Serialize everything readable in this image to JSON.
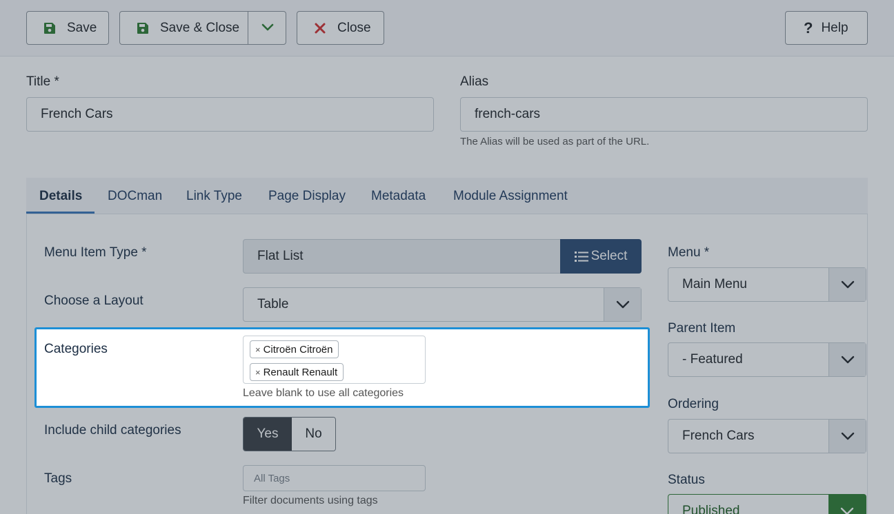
{
  "toolbar": {
    "save": "Save",
    "save_close": "Save & Close",
    "close": "Close",
    "help": "Help",
    "help_glyph": "?"
  },
  "title_field": {
    "label": "Title *",
    "value": "French Cars"
  },
  "alias_field": {
    "label": "Alias",
    "value": "french-cars",
    "hint": "The Alias will be used as part of the URL."
  },
  "tabs": [
    {
      "label": "Details",
      "active": true
    },
    {
      "label": "DOCman"
    },
    {
      "label": "Link Type"
    },
    {
      "label": "Page Display"
    },
    {
      "label": "Metadata"
    },
    {
      "label": "Module Assignment"
    }
  ],
  "details": {
    "menu_item_type": {
      "label": "Menu Item Type *",
      "value": "Flat List",
      "button": "Select"
    },
    "layout": {
      "label": "Choose a Layout",
      "value": "Table"
    },
    "categories": {
      "label": "Categories",
      "chips": [
        "Citroën Citroën",
        "Renault Renault"
      ],
      "chip_remove": "×",
      "hint": "Leave blank to use all categories"
    },
    "include_children": {
      "label": "Include child categories",
      "yes": "Yes",
      "no": "No",
      "selected": "Yes"
    },
    "tags": {
      "label": "Tags",
      "placeholder": "All Tags",
      "hint": "Filter documents using tags"
    }
  },
  "sidebar": {
    "menu": {
      "label": "Menu *",
      "value": "Main Menu"
    },
    "parent": {
      "label": "Parent Item",
      "value": "- Featured"
    },
    "ordering": {
      "label": "Ordering",
      "value": "French Cars"
    },
    "status": {
      "label": "Status",
      "value": "Published"
    }
  },
  "colors": {
    "accent": "#2b4a72",
    "focus": "#1d8fd6",
    "save_icon": "#2e7d32",
    "close_icon": "#d32f2f",
    "status_green": "#2f7d32"
  },
  "icons": {
    "save": "floppy-disk-icon",
    "close": "x-icon",
    "help": "question-mark-icon",
    "dropdown": "chevron-down-icon",
    "select": "list-icon"
  }
}
